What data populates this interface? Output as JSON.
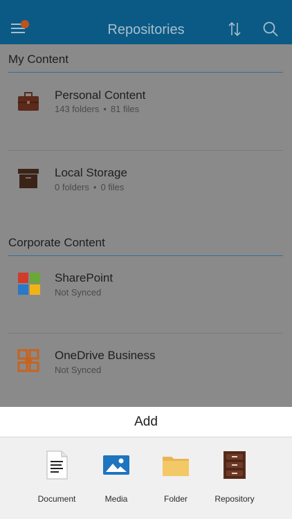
{
  "header": {
    "title": "Repositories",
    "menu_icon": "hamburger-icon",
    "sort_icon": "sort-icon",
    "search_icon": "search-icon",
    "notification_color": "#c0521e",
    "bar_color": "#0b5a85"
  },
  "sections": [
    {
      "title": "My Content",
      "items": [
        {
          "name": "Personal Content",
          "folders": "143 folders",
          "files": "81 files",
          "icon": "briefcase-icon"
        },
        {
          "name": "Local Storage",
          "folders": "0 folders",
          "files": "0 files",
          "icon": "storage-box-icon"
        }
      ]
    },
    {
      "title": "Corporate Content",
      "items": [
        {
          "name": "SharePoint",
          "status": "Not Synced",
          "icon": "sharepoint-icon"
        },
        {
          "name": "OneDrive Business",
          "status": "Not Synced",
          "icon": "onedrive-business-icon"
        }
      ]
    }
  ],
  "add_sheet": {
    "title": "Add",
    "options": [
      {
        "label": "Document",
        "icon": "document-icon"
      },
      {
        "label": "Media",
        "icon": "media-icon"
      },
      {
        "label": "Folder",
        "icon": "folder-icon"
      },
      {
        "label": "Repository",
        "icon": "repository-icon"
      }
    ]
  }
}
